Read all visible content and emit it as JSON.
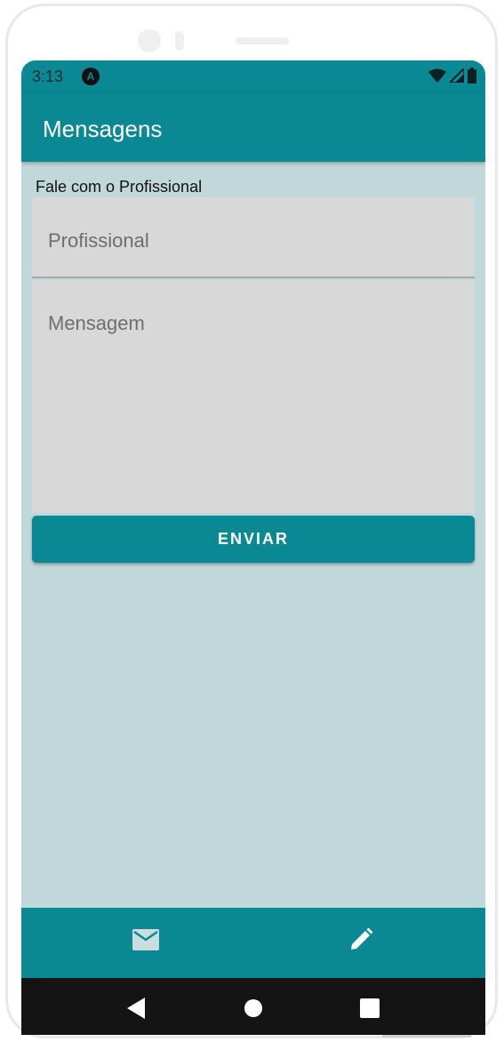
{
  "status_bar": {
    "time": "3:13",
    "app_icon": "android-app-icon",
    "icons": [
      "wifi-icon",
      "signal-icon",
      "battery-icon"
    ]
  },
  "app_bar": {
    "title": "Mensagens"
  },
  "form": {
    "section_label": "Fale com o Profissional",
    "professional_placeholder": "Profissional",
    "professional_value": "",
    "message_placeholder": "Mensagem",
    "message_value": "",
    "send_label": "ENVIAR"
  },
  "bottom_nav": {
    "items": [
      {
        "icon": "mail-icon"
      },
      {
        "icon": "pencil-icon"
      }
    ]
  },
  "system_nav": {
    "buttons": [
      "back-icon",
      "home-icon",
      "recents-icon"
    ]
  },
  "colors": {
    "primary": "#0a8894",
    "background": "#c0d8da",
    "field": "#d8d8d8",
    "system_nav": "#141414"
  }
}
